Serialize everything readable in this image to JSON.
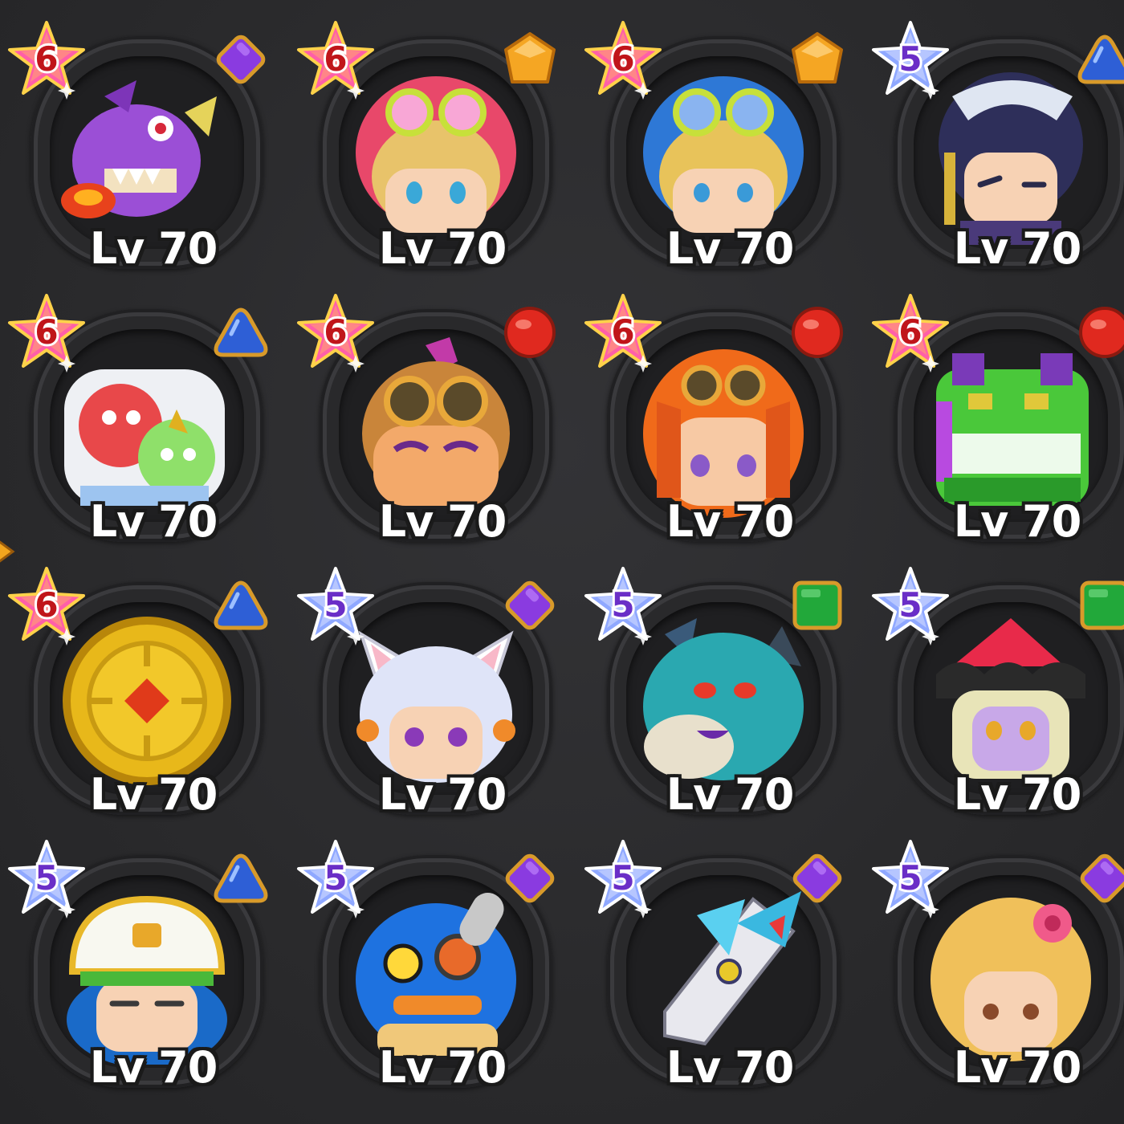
{
  "rows": [
    [
      {
        "rank": "6",
        "element": "dark",
        "level": "Lv 70",
        "portrait": "purple-dragon"
      },
      {
        "rank": "6",
        "element": "light",
        "level": "Lv 70",
        "portrait": "goggles-girl-red-hood"
      },
      {
        "rank": "6",
        "element": "light",
        "level": "Lv 70",
        "portrait": "goggles-boy-blue-hood"
      },
      {
        "rank": "5",
        "element": "water",
        "level": "Lv 70",
        "portrait": "dark-hair-swordsman"
      }
    ],
    [
      {
        "rank": "6",
        "element": "water",
        "level": "Lv 70",
        "portrait": "slime-duo"
      },
      {
        "rank": "6",
        "element": "fire",
        "level": "Lv 70",
        "portrait": "purple-hair-goggles-boy"
      },
      {
        "rank": "6",
        "element": "fire",
        "level": "Lv 70",
        "portrait": "orange-hair-girl"
      },
      {
        "rank": "6",
        "element": "fire",
        "level": "Lv 70",
        "portrait": "green-dragon"
      }
    ],
    [
      {
        "rank": "6",
        "element": "water",
        "level": "Lv 70",
        "portrait": "golden-medallion"
      },
      {
        "rank": "5",
        "element": "dark",
        "level": "Lv 70",
        "portrait": "white-fox-girl"
      },
      {
        "rank": "5",
        "element": "earth",
        "level": "Lv 70",
        "portrait": "teal-ogre"
      },
      {
        "rank": "5",
        "element": "earth",
        "level": "Lv 70",
        "portrait": "red-hat-witch"
      }
    ],
    [
      {
        "rank": "5",
        "element": "water",
        "level": "Lv 70",
        "portrait": "hardhat-kid"
      },
      {
        "rank": "5",
        "element": "dark",
        "level": "Lv 70",
        "portrait": "blue-monocle-blob"
      },
      {
        "rank": "5",
        "element": "dark",
        "level": "Lv 70",
        "portrait": "winged-sword"
      },
      {
        "rank": "5",
        "element": "dark",
        "level": "Lv 70",
        "portrait": "blonde-flower-girl"
      }
    ]
  ],
  "colors": {
    "background": "#2b2b2d",
    "rank6_star": "#ff5fa8",
    "rank5_star": "#8fa8ff",
    "rank6_number": "#c0151a",
    "rank5_number": "#6a2ec7",
    "element_dark": "#8a3be0",
    "element_light": "#f5a623",
    "element_water": "#2e5fd6",
    "element_fire": "#e0291f",
    "element_earth": "#22a83a"
  }
}
